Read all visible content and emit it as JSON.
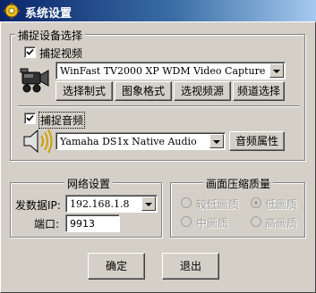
{
  "window": {
    "title": "系统设置",
    "icon": "settings-app-icon"
  },
  "capture_group": {
    "legend": "捕捉设备选择",
    "video": {
      "checkbox_label": "捕捉视频",
      "checked": true,
      "device": "WinFast TV2000 XP WDM Video Capture",
      "icon": "video-camera-icon",
      "buttons": [
        "选择制式",
        "图象格式",
        "选视频源",
        "频道选择"
      ]
    },
    "audio": {
      "checkbox_label": "捕捉音频",
      "checked": true,
      "device": "Yamaha DS1x Native Audio",
      "icon": "speaker-icon",
      "properties_button": "音频属性"
    }
  },
  "network_group": {
    "legend": "网络设置",
    "ip_label": "发数据IP:",
    "ip_value": "192.168.1.8",
    "port_label": "端口:",
    "port_value": "9913"
  },
  "compression_group": {
    "legend": "画面压缩质量",
    "options": [
      "较低画质",
      "低画质",
      "中画质",
      "高画质"
    ],
    "selected": "低画质",
    "enabled": false
  },
  "footer": {
    "ok_label": "确定",
    "exit_label": "退出"
  }
}
